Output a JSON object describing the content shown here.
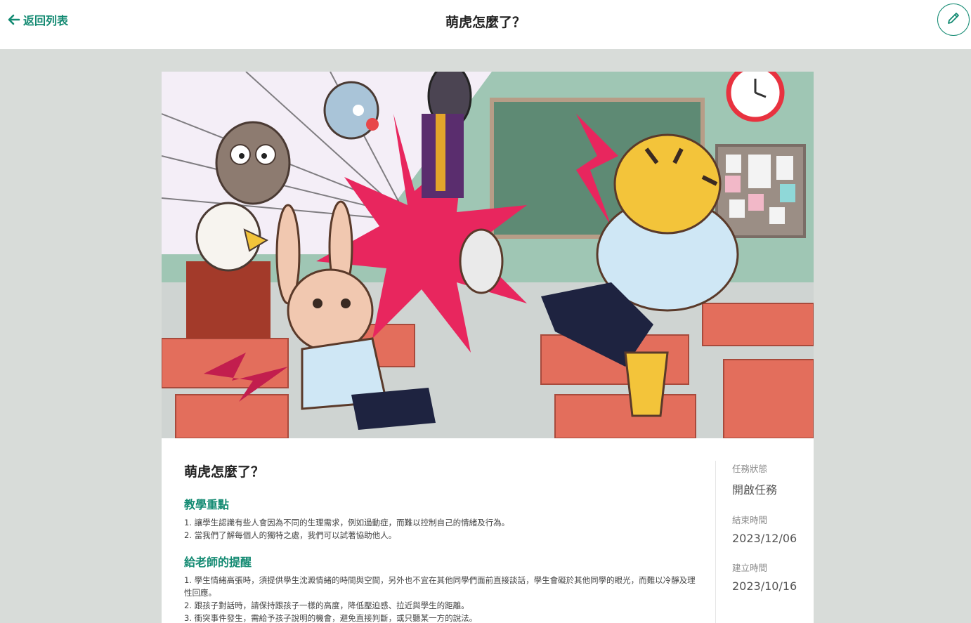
{
  "header": {
    "back_label": "返回列表",
    "title": "萌虎怎麼了？",
    "edit_icon": "pencil-icon"
  },
  "illustration": {
    "subject": "classroom-comic-illustration",
    "colors": {
      "wall": "#9fc6b4",
      "chalkboard": "#5e8a74",
      "floor": "#cfd4d2",
      "desk": "#e36e5c",
      "burst": "#e8265e",
      "tiger": "#f3c43a",
      "shirt": "#cfe7f5",
      "clock": "#e8323f"
    }
  },
  "task": {
    "title": "萌虎怎麼了？",
    "sections": [
      {
        "heading": "教學重點",
        "items": [
          "1. 讓學生認識有些人會因為不同的生理需求，例如過動症，而難以控制自己的情緒及行為。",
          "2. 當我們了解每個人的獨特之處，我們可以試著協助他人。"
        ]
      },
      {
        "heading": "給老師的提醒",
        "items": [
          "1. 學生情緒高張時，須提供學生沈澱情緒的時間與空間，另外也不宜在其他同學們面前直接談話，學生會礙於其他同學的眼光，而難以冷靜及理性回應。",
          "2. 跟孩子對話時，請保持跟孩子一樣的高度，降低壓迫感、拉近與學生的距離。",
          "3. 衝突事件發生，需給予孩子說明的機會，避免直接判斷，或只聽某一方的說法。"
        ]
      }
    ]
  },
  "meta": {
    "status_label": "任務狀態",
    "status_value": "開啟任務",
    "end_label": "結束時間",
    "end_value": "2023/12/06",
    "created_label": "建立時間",
    "created_value": "2023/10/16"
  },
  "colors": {
    "accent": "#138a72",
    "page_bg": "#d8dcd9"
  }
}
